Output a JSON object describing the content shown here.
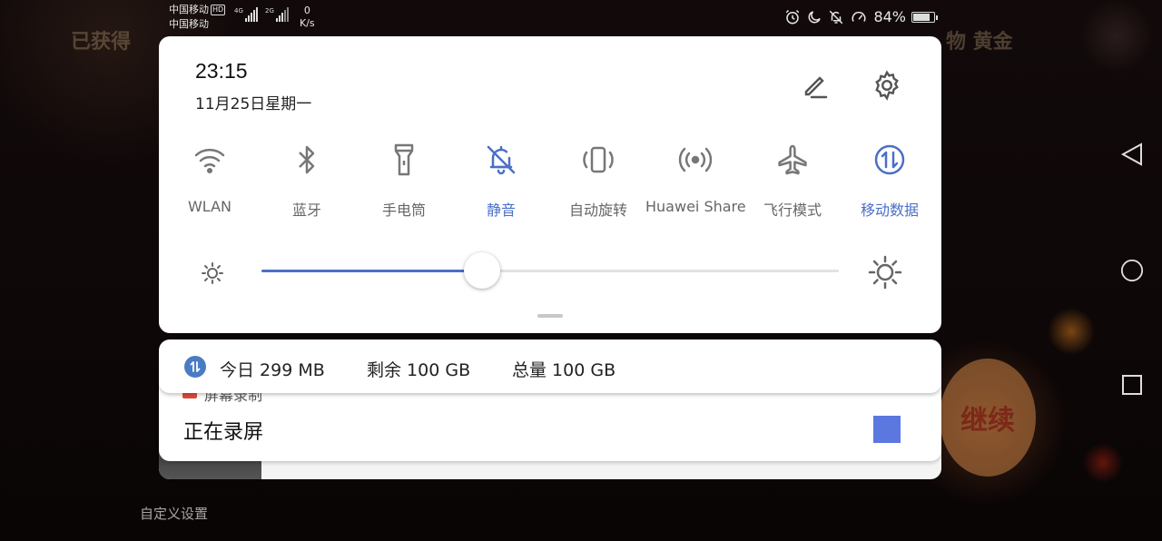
{
  "status_bar": {
    "carrier_1": "中国移动",
    "carrier_1_badge": "HD",
    "carrier_2": "中国移动",
    "signal_1_type": "4G",
    "signal_2_type": "2G",
    "net_speed_value": "0",
    "net_speed_unit": "K/s",
    "battery_percent": "84%",
    "battery_level": 0.84
  },
  "background": {
    "top_left_text": "已获得",
    "top_right_text": "物 黄金"
  },
  "quick_panel": {
    "time": "23:15",
    "date": "11月25日星期一",
    "tiles": [
      {
        "label": "WLAN",
        "icon": "wifi-icon",
        "active": false
      },
      {
        "label": "蓝牙",
        "icon": "bluetooth-icon",
        "active": false
      },
      {
        "label": "手电筒",
        "icon": "flashlight-icon",
        "active": false
      },
      {
        "label": "静音",
        "icon": "bell-off-icon",
        "active": true
      },
      {
        "label": "自动旋转",
        "icon": "auto-rotate-icon",
        "active": false
      },
      {
        "label": "Huawei Share",
        "icon": "huawei-share-icon",
        "active": false
      },
      {
        "label": "飞行模式",
        "icon": "airplane-icon",
        "active": false
      },
      {
        "label": "移动数据",
        "icon": "mobile-data-icon",
        "active": true
      }
    ],
    "brightness_level": 0.382
  },
  "data_usage": {
    "today": "今日 299 MB",
    "remaining": "剩余 100 GB",
    "total": "总量 100 GB"
  },
  "notification": {
    "app_name": "屏幕录制",
    "title": "正在录屏"
  },
  "custom_settings_label": "自定义设置",
  "colors": {
    "accent": "#4a6fc7",
    "stop_button": "#5b78e0",
    "data_icon": "#4a7cc4"
  }
}
